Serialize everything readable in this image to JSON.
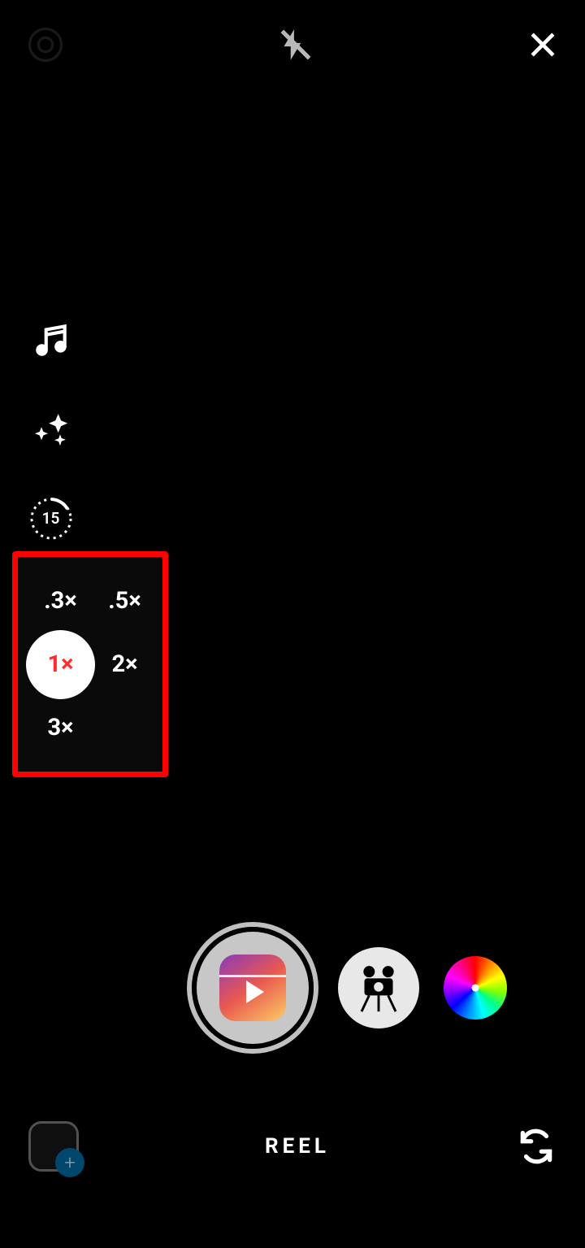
{
  "topBar": {
    "settings": "settings",
    "flash": "flash-off",
    "close": "close"
  },
  "sideTools": {
    "music": "Audio",
    "effects": "Effects",
    "duration": "15",
    "speed": "Speed"
  },
  "speedOptions": {
    "opt1": ".3×",
    "opt2": ".5×",
    "opt3": "1×",
    "opt4": "2×",
    "opt5": "3×",
    "selected": "1×"
  },
  "mode": {
    "label": "REEL"
  },
  "bottomBar": {
    "gallery": "Gallery",
    "switchCamera": "Switch camera"
  }
}
